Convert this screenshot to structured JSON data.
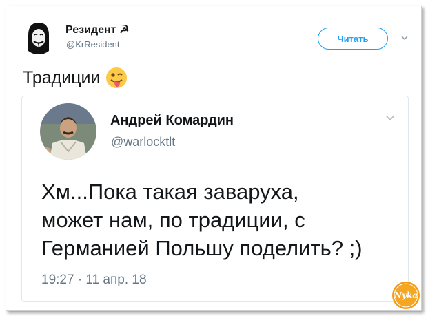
{
  "author": {
    "name": "Резидент ☭",
    "handle": "@KrResident"
  },
  "follow_button": {
    "label": "Читать"
  },
  "tweet": {
    "text": "Традиции"
  },
  "quoted": {
    "name": "Андрей Комардин",
    "handle": "@warlocktlt",
    "text_lines": [
      "Хм...Пока такая заваруха,",
      "может нам, по традиции, с",
      "Германией Польшу поделить? ;)"
    ],
    "timestamp": "19:27 · 11 апр. 18"
  },
  "watermark": {
    "text": "Nyka"
  },
  "colors": {
    "accent": "#1da1f2",
    "text": "#14171a",
    "muted": "#657786",
    "border": "#e1e8ed",
    "watermark_orange": "#f39c12"
  },
  "icons": {
    "caret": "chevron-down-icon",
    "emoji": "winking-face-with-tongue-icon"
  }
}
